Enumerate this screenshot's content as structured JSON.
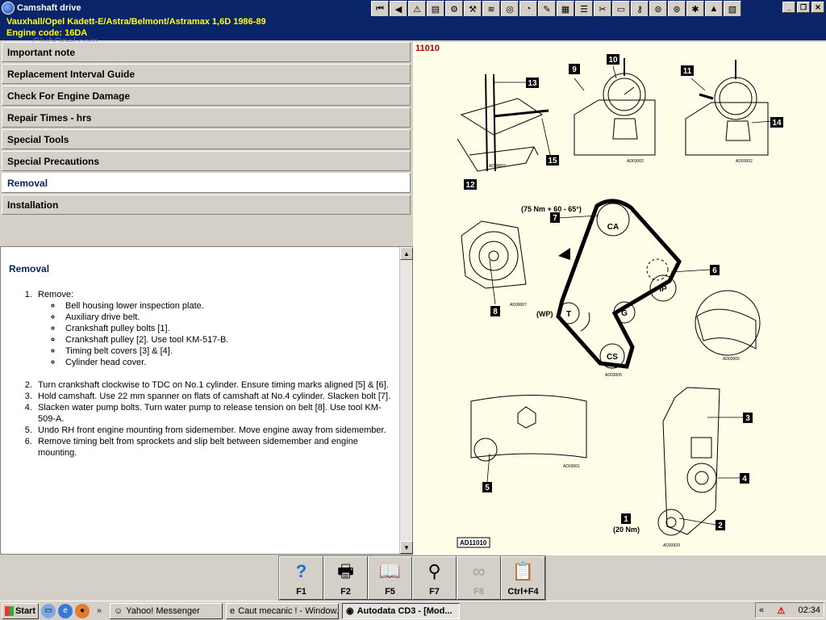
{
  "window": {
    "title": "Camshaft drive"
  },
  "info": {
    "vehicle": "Vauxhall/Opel   Kadett-E/Astra/Belmont/Astramax  1,6D  1986-89",
    "engine_code": "Engine code: 16DA",
    "watermark": "ClubOpel.com"
  },
  "menu": {
    "items": [
      {
        "label": "Important note"
      },
      {
        "label": "Replacement Interval Guide"
      },
      {
        "label": "Check For Engine Damage"
      },
      {
        "label": "Repair Times - hrs"
      },
      {
        "label": "Special Tools"
      },
      {
        "label": "Special Precautions"
      },
      {
        "label": "Removal"
      },
      {
        "label": "Installation"
      }
    ]
  },
  "content": {
    "heading": "Removal",
    "steps": [
      "Remove:",
      "Turn crankshaft clockwise to TDC on No.1 cylinder. Ensure timing marks aligned [5] & [6].",
      "Hold camshaft. Use 22 mm spanner on flats of camshaft at No.4 cylinder. Slacken bolt [7].",
      "Slacken water pump bolts. Turn water pump to release tension on belt [8]. Use tool KM-509-A.",
      "Undo RH front engine mounting from sidemember. Move engine away from sidemember.",
      "Remove timing belt from sprockets and slip belt between sidemember and engine mounting."
    ],
    "remove_subitems": [
      "Bell housing lower inspection plate.",
      "Auxiliary drive belt.",
      "Crankshaft pulley bolts [1].",
      "Crankshaft pulley [2]. Use tool KM-517-B.",
      "Timing belt covers [3] & [4].",
      "Cylinder head cover."
    ]
  },
  "diagram": {
    "code": "11010",
    "footer": "AD11010",
    "torque_camshaft": "(75 Nm + 60 - 65°)",
    "torque_crank": "(20 Nm)",
    "wp_label": "(WP)",
    "pulleys": [
      "CA",
      "IP",
      "T",
      "G",
      "CS"
    ],
    "callouts": [
      "1",
      "2",
      "3",
      "4",
      "5",
      "6",
      "7",
      "8",
      "9",
      "10",
      "11",
      "12",
      "13",
      "14",
      "15"
    ],
    "small_codes": [
      "AD09603",
      "AD03002",
      "AD03002",
      "AD09007",
      "AD03005",
      "AD03005",
      "AD03001",
      "AD93929"
    ]
  },
  "fkeys": [
    {
      "label": "F1",
      "icon": "help-icon",
      "glyph": "?"
    },
    {
      "label": "F2",
      "icon": "print-icon",
      "glyph": "🖶"
    },
    {
      "label": "F5",
      "icon": "book-icon",
      "glyph": "📖"
    },
    {
      "label": "F7",
      "icon": "tool-icon",
      "glyph": "⚲"
    },
    {
      "label": "F8",
      "icon": "belt-icon",
      "glyph": "∞"
    },
    {
      "label": "Ctrl+F4",
      "icon": "exit-icon",
      "glyph": "📋"
    }
  ],
  "taskbar": {
    "start": "Start",
    "tasks": [
      {
        "label": "Yahoo! Messenger"
      },
      {
        "label": "Caut mecanic ! - Window..."
      },
      {
        "label": "Autodata CD3 - [Mod..."
      }
    ],
    "clock": "02:34"
  }
}
